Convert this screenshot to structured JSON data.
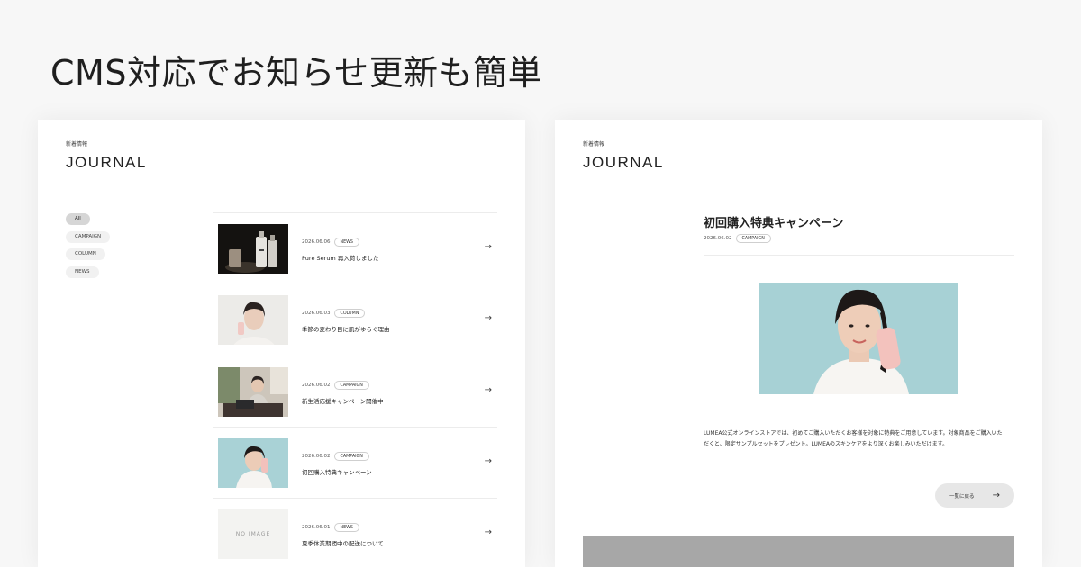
{
  "headline": "CMS対応でお知らせ更新も簡単",
  "left": {
    "kicker": "新着情報",
    "brand": "JOURNAL",
    "filters": [
      "All",
      "CAMPAIGN",
      "COLUMN",
      "NEWS"
    ],
    "items": [
      {
        "date": "2026.06.06",
        "tag": "NEWS",
        "title": "Pure Serum 再入荷しました",
        "arrow": "→"
      },
      {
        "date": "2026.06.03",
        "tag": "COLUMN",
        "title": "季節の変わり目に肌がゆらぐ理由",
        "arrow": "→"
      },
      {
        "date": "2026.06.02",
        "tag": "CAMPAIGN",
        "title": "新生活応援キャンペーン開催中",
        "arrow": "→"
      },
      {
        "date": "2026.06.02",
        "tag": "CAMPAIGN",
        "title": "初回購入特典キャンペーン",
        "arrow": "→"
      },
      {
        "date": "2026.06.01",
        "tag": "NEWS",
        "title": "夏季休業期間中の配送について",
        "arrow": "→",
        "placeholder": "NO IMAGE"
      }
    ]
  },
  "right": {
    "kicker": "新着情報",
    "brand": "JOURNAL",
    "article": {
      "title": "初回購入特典キャンペーン",
      "date": "2026.06.02",
      "tag": "CAMPAIGN",
      "body_line1": "LUMEA公式オンラインストアでは、初めてご購入いただくお客様を対象に特典をご用意しています。対象商品をご購入いた",
      "body_line2": "だくと、限定サンプルセットをプレゼント。LUMEAのスキンケアをより深くお楽しみいただけます。",
      "back_label": "一覧に戻る",
      "back_arrow": "→"
    }
  }
}
